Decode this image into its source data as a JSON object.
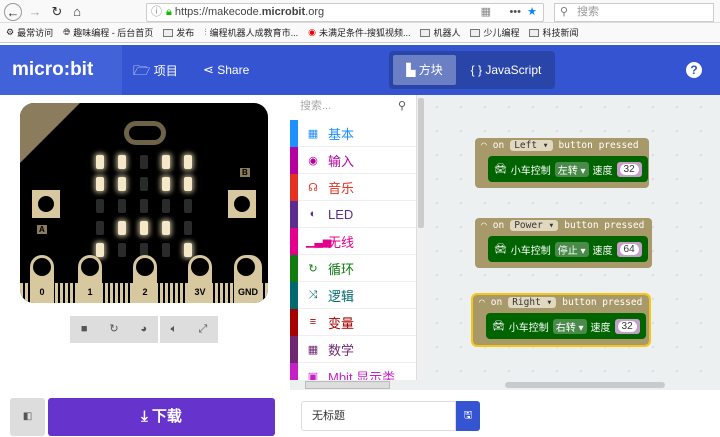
{
  "browser": {
    "url_prefix": "https://makecode.",
    "url_domain": "microbit",
    "url_suffix": ".org",
    "search_placeholder": "搜索",
    "bookmarks": [
      "最常访问",
      "趣味编程 - 后台首页",
      "发布",
      "编程机器人成教育市...",
      "未满足条件-搜狐视频...",
      "机器人",
      "少儿编程",
      "科技新闻"
    ]
  },
  "header": {
    "logo": "micro:bit",
    "projects": "项目",
    "share": "Share",
    "blocks_tab": "方块",
    "js_tab": "JavaScript",
    "help": "?"
  },
  "simulator": {
    "leds": [
      [
        1,
        1,
        0,
        1,
        1
      ],
      [
        1,
        1,
        0,
        1,
        1
      ],
      [
        0,
        0,
        0,
        0,
        0
      ],
      [
        0,
        1,
        1,
        1,
        0
      ],
      [
        1,
        0,
        0,
        0,
        1
      ]
    ],
    "pins": [
      "0",
      "1",
      "2",
      "3V",
      "GND"
    ],
    "button_a": "A",
    "button_b": "B"
  },
  "toolbox": {
    "search_placeholder": "搜索...",
    "categories": [
      {
        "label": "基本",
        "color": "#1e90ff",
        "icon": "▦"
      },
      {
        "label": "输入",
        "color": "#b4009e",
        "icon": "◉"
      },
      {
        "label": "音乐",
        "color": "#e63022",
        "icon": "☊"
      },
      {
        "label": "LED",
        "color": "#5c2d91",
        "icon": "◐"
      },
      {
        "label": "无线",
        "color": "#e3008c",
        "icon": "▁▃▅"
      },
      {
        "label": "循环",
        "color": "#107c10",
        "icon": "↻"
      },
      {
        "label": "逻辑",
        "color": "#006970",
        "icon": "⤨"
      },
      {
        "label": "变量",
        "color": "#a80000",
        "icon": "≡"
      },
      {
        "label": "数学",
        "color": "#712672",
        "icon": "▦"
      },
      {
        "label": "Mbit 显示类",
        "color": "#c71fc7",
        "icon": "▣"
      }
    ]
  },
  "workspace": {
    "blocks": [
      {
        "on": "on",
        "button": "Left",
        "pressed": "button pressed",
        "action": "小车控制",
        "dir": "左转",
        "speed_label": "速度",
        "speed": "32"
      },
      {
        "on": "on",
        "button": "Power",
        "pressed": "button pressed",
        "action": "小车控制",
        "dir": "停止",
        "speed_label": "速度",
        "speed": "64"
      },
      {
        "on": "on",
        "button": "Right",
        "pressed": "button pressed",
        "action": "小车控制",
        "dir": "右转",
        "speed_label": "速度",
        "speed": "32"
      }
    ]
  },
  "bottom": {
    "download": "下载",
    "project_name": "无标题"
  }
}
